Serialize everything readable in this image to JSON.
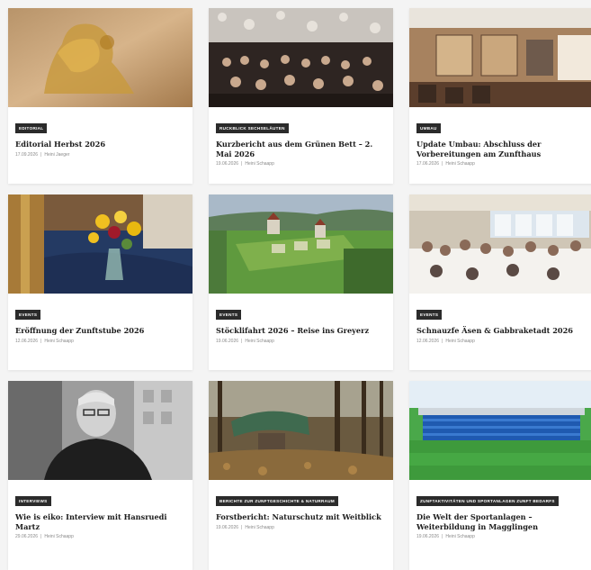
{
  "cards": [
    {
      "badge": "EDITORIAL",
      "title": "Editorial Herbst 2026",
      "date": "17.09.2026",
      "author": "Heini Jaeger"
    },
    {
      "badge": "RUCKBLICK SECHSELÄUTEN",
      "title": "Kurzbericht aus dem Grünen Bett – 2. Mai 2026",
      "date": "19.06.2026",
      "author": "Heini Schaapp"
    },
    {
      "badge": "UMBAU",
      "title": "Update Umbau: Abschluss der Vorbereitungen am Zunfthaus",
      "date": "17.06.2026",
      "author": "Heini Schaapp"
    },
    {
      "badge": "EVENTS",
      "title": "Eröffnung der Zunftstube 2026",
      "date": "12.06.2026",
      "author": "Heini Schaapp"
    },
    {
      "badge": "EVENTS",
      "title": "Stöcklifahrt 2026 – Reise ins Greyerz",
      "date": "19.06.2026",
      "author": "Heini Schaapp"
    },
    {
      "badge": "EVENTS",
      "title": "Schnauzfe Äsen & Gabbraketadt 2026",
      "date": "12.06.2026",
      "author": "Heini Schaapp"
    },
    {
      "badge": "INTERVIEWS",
      "title": "Wie is eiko: Interview mit Hansruedi Martz",
      "date": "29.06.2026",
      "author": "Heini Schaapp"
    },
    {
      "badge": "BERICHTE ZUR ZUNFTGESCHICHTE & NATURRAUM",
      "title": "Forstbericht: Naturschutz mit Weitblick",
      "date": "19.06.2026",
      "author": "Heini Schaapp"
    },
    {
      "badge": "ZUNFTAKTIVITÄTEN UND SPORTANLAGEN ZUNFT BEDARFS",
      "title": "Die Welt der Sportanlagen – Weiterbildung in Magglingen",
      "date": "19.06.2026",
      "author": "Heini Schaapp"
    }
  ],
  "meta_separator": "|"
}
